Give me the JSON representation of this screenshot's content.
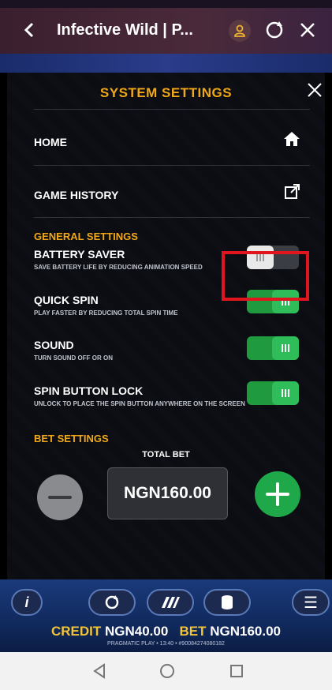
{
  "browser": {
    "title": "Infective Wild | P..."
  },
  "panel": {
    "title": "SYSTEM SETTINGS",
    "rows": [
      {
        "label": "HOME"
      },
      {
        "label": "GAME HISTORY"
      }
    ],
    "general_section": "GENERAL SETTINGS",
    "toggles": [
      {
        "label": "BATTERY SAVER",
        "sub": "SAVE BATTERY LIFE BY REDUCING ANIMATION SPEED",
        "on": false
      },
      {
        "label": "QUICK SPIN",
        "sub": "PLAY FASTER BY REDUCING TOTAL SPIN TIME",
        "on": true
      },
      {
        "label": "SOUND",
        "sub": "TURN SOUND OFF OR ON",
        "on": true
      },
      {
        "label": "SPIN BUTTON LOCK",
        "sub": "UNLOCK TO PLACE THE SPIN BUTTON ANYWHERE ON THE SCREEN",
        "on": true
      }
    ],
    "bet_section": "BET SETTINGS",
    "total_bet_label": "TOTAL BET",
    "total_bet_value": "NGN160.00"
  },
  "bottom": {
    "credit_label": "CREDIT",
    "credit_value": "NGN40.00",
    "bet_label": "BET",
    "bet_value": "NGN160.00",
    "footer": "PRAGMATIC PLAY • 13:40 • #90084274080182"
  },
  "colors": {
    "accent": "#f0a818",
    "toggle_on": "#1f9a3f",
    "highlight": "#e0151d"
  }
}
